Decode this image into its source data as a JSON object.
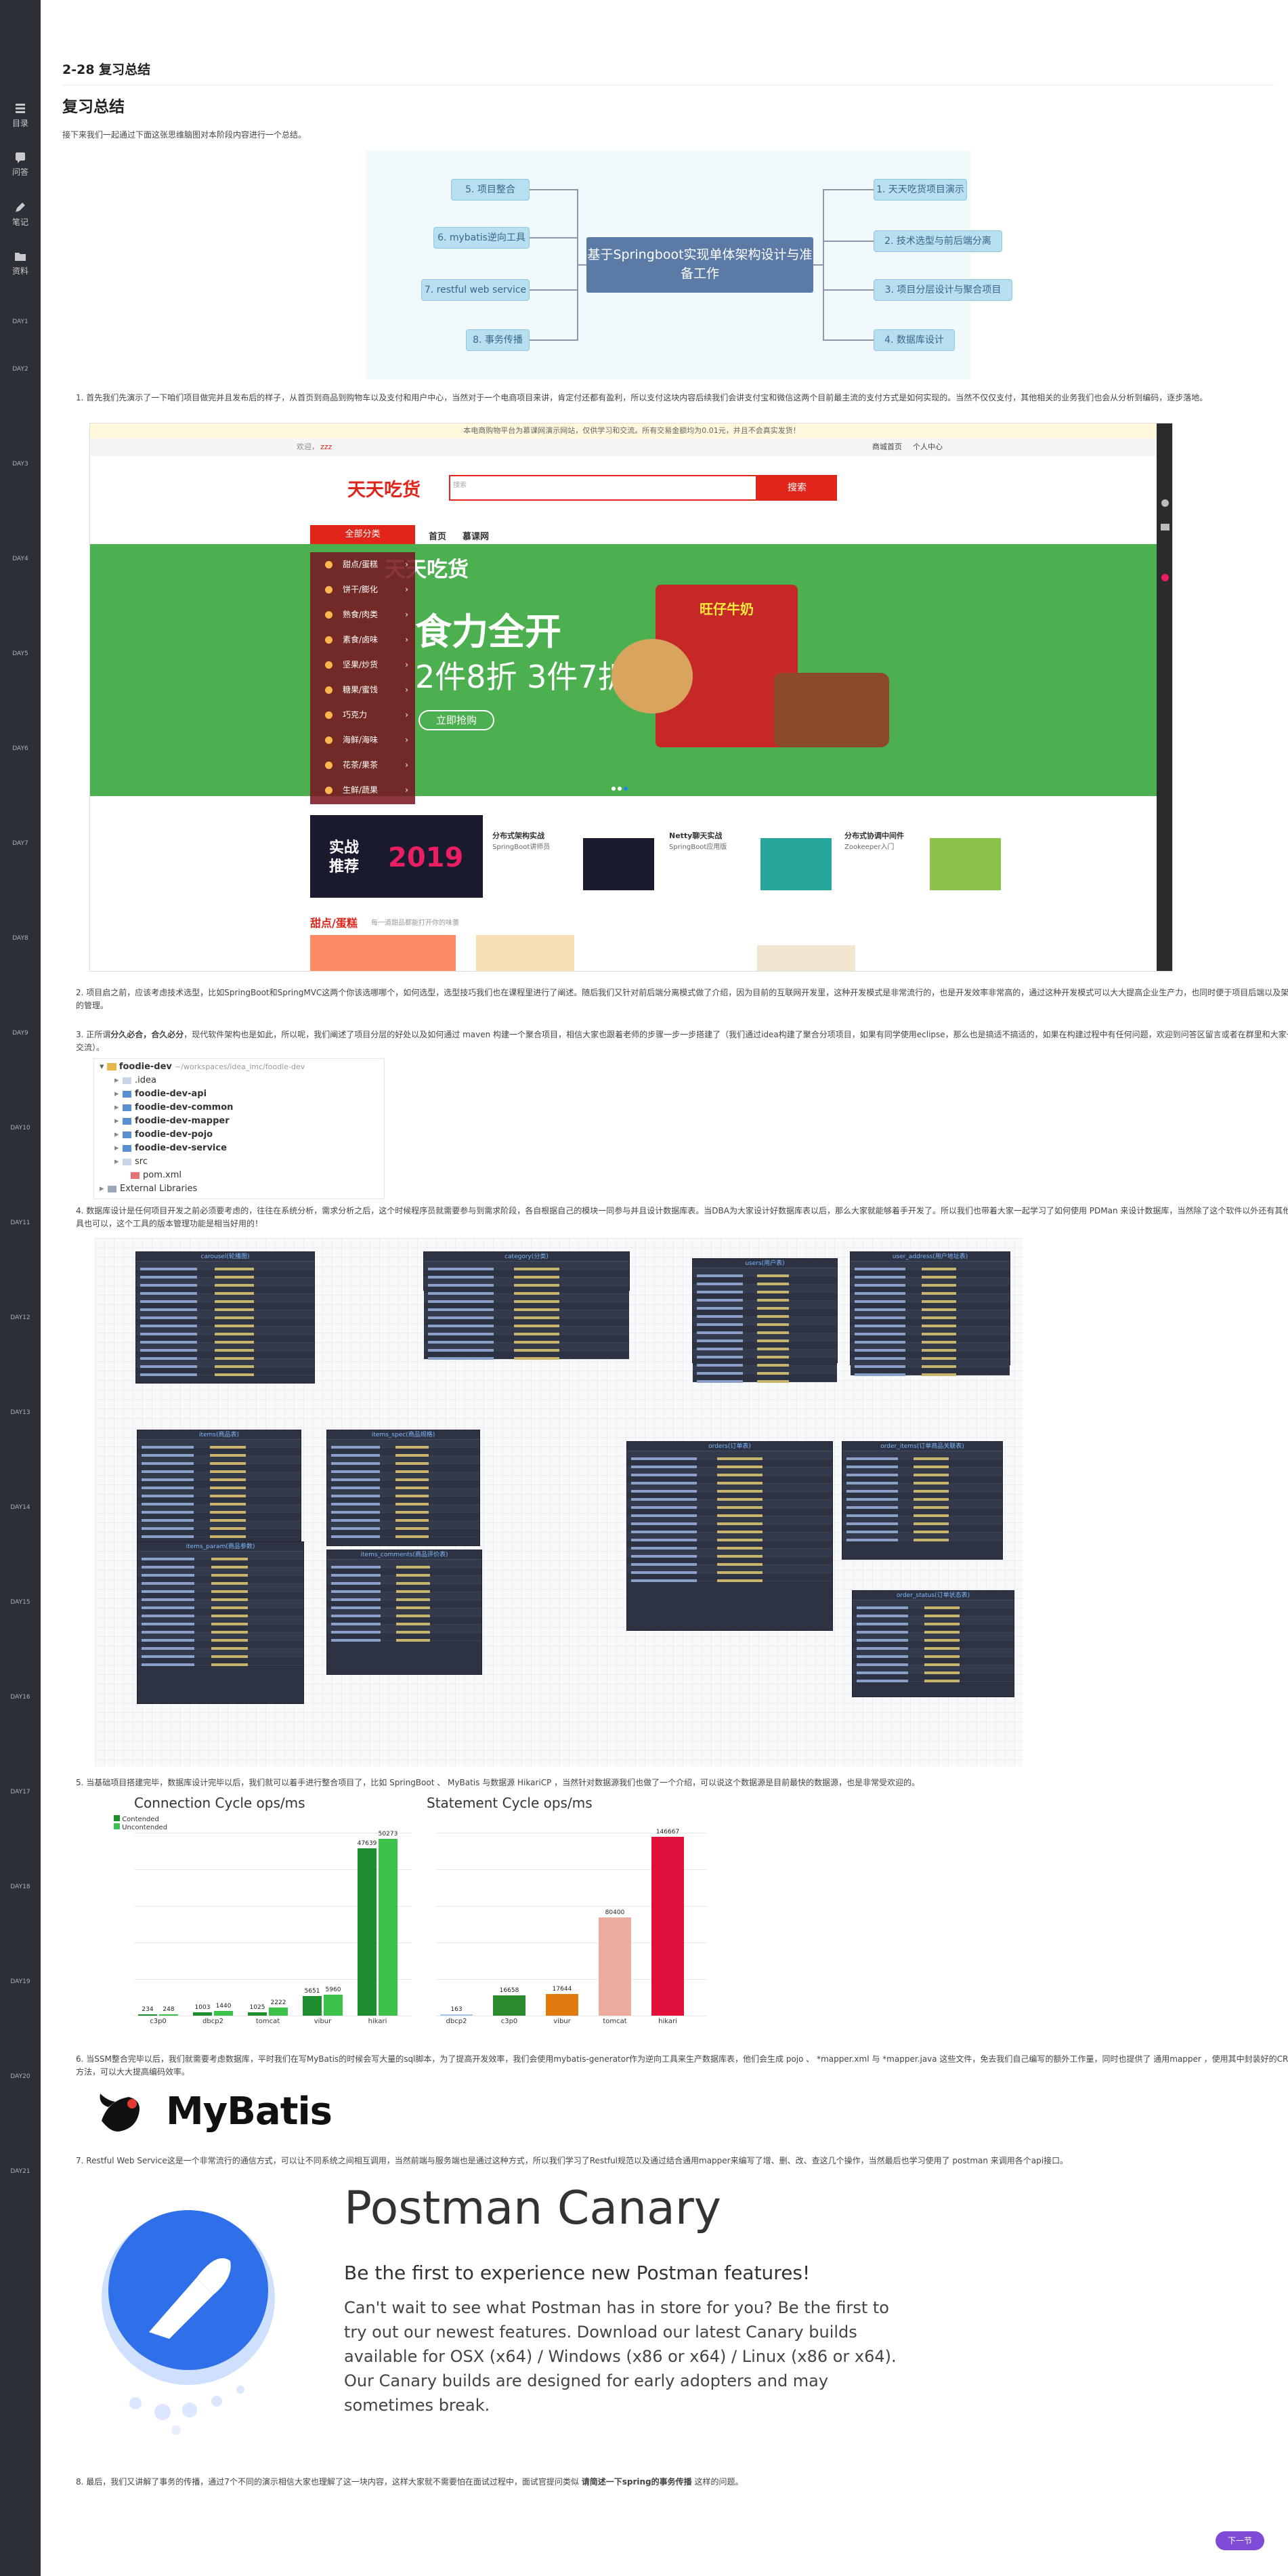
{
  "sidebar": {
    "items": [
      {
        "icon": "catalog-icon",
        "label": "目录"
      },
      {
        "icon": "question-icon",
        "label": "问答"
      },
      {
        "icon": "pen-icon",
        "label": "笔记"
      },
      {
        "icon": "folder-icon",
        "label": "资料"
      }
    ],
    "day_labels": [
      "DAY1",
      "DAY2",
      "DAY3",
      "DAY4",
      "DAY5",
      "DAY6",
      "DAY7",
      "DAY8",
      "DAY9",
      "DAY10",
      "DAY11",
      "DAY12",
      "DAY13",
      "DAY14",
      "DAY15",
      "DAY16",
      "DAY17",
      "DAY18",
      "DAY19",
      "DAY20",
      "DAY21"
    ]
  },
  "lesson": {
    "breadcrumb_title": "2-28 复习总结",
    "page_title": "复习总结",
    "intro": "接下来我们一起通过下面这张思维脑图对本阶段内容进行一个总结。"
  },
  "mindmap": {
    "center": "基于Springboot实现单体架构设计与准备工作",
    "left": [
      "5. 项目整合",
      "6. mybatis逆向工具",
      "7. restful web service",
      "8. 事务传播"
    ],
    "right": [
      "1. 天天吃货项目演示",
      "2. 技术选型与前后端分离",
      "3. 项目分层设计与聚合项目",
      "4. 数据库设计"
    ]
  },
  "points": {
    "p1": "首先我们先演示了一下咱们项目做完并且发布后的样子，从首页到商品到购物车以及支付和用户中心，当然对于一个电商项目来讲，肯定付还都有盈利，所以支付这块内容后续我们会讲支付宝和微信这两个目前最主流的支付方式是如何实现的。当然不仅仅支付，其他相关的业务我们也会从分析到编码，逐步落地。",
    "p2": "项目启之前，应该考虑技术选型，比如SpringBoot和SpringMVC这两个你该选哪哪个，如何选型，选型技巧我们也在课程里进行了阐述。随后我们又针对前后端分离模式做了介绍，因为目前的互联网开发里，这种开发模式是非常流行的，也是开发效率非常高的，通过这种开发模式可以大大提高企业生产力，也同时便于项目后端以及架构间的管理。",
    "p3_lead": "正所谓",
    "p3_bold": "分久必合，合久必分",
    "p3_rest": "，现代软件架构也是如此，所以呢，我们阐述了项目分层的好处以及如何通过 maven 构建一个聚合项目，相信大家也跟着老师的步骤一步一步搭建了（我们通过idea构建了聚合分项项目，如果有同学使用eclipse，那么也是搞适不搞适的，如果在构建过程中有任何问题，欢迎到问答区留言或者在群里和大家一起交流）。",
    "p4": "数据库设计是任何项目开发之前必须要考虑的，往往在系统分析，需求分析之后，这个时候程序员就需要参与到需求阶段，各自根据自己的模块一同参与并且设计数据库表。当DBA为大家设计好数据库表以后，那么大家就能够着手开发了。所以我们也带着大家一起学习了如何使用 PDMan 来设计数据库，当然除了这个软件以外还有其他的工具也可以，这个工具的版本管理功能是相当好用的！",
    "p5": "当基础项目搭建完毕，数据库设计完毕以后，我们就可以着手进行整合项目了，比如 SpringBoot 、 MyBatis 与数据源 HikariCP ，当然针对数据源我们也做了一个介绍，可以说这个数据源是目前最快的数据源，也是非常受欢迎的。",
    "p6": "当SSM整合完毕以后，我们就需要考虑数据库，平时我们在写MyBatis的时候会写大量的sql脚本，为了提高开发效率，我们会使用mybatis-generator作为逆向工具来生产数据库表，他们会生成 pojo 、 *mapper.xml 与 *mapper.java 这些文件，免去我们自己编写的额外工作量，同时也提供了 通用mapper ，使用其中封装好的CRUD方法，可以大大提高编码效率。",
    "p7": "Restful Web Service这是一个非常流行的通信方式，可以让不同系统之间相互调用，当然前端与服务端也是通过这种方式，所以我们学习了Restful规范以及通过结合通用mapper来编写了增、删、改、查这几个操作，当然最后也学习使用了 postman 来调用各个api接口。",
    "p8_lead": "最后，我们又讲解了事务的传播，通过7个不同的演示相信大家也理解了这一块内容，这样大家就不需要怕在面试过程中，面试官提问类似 ",
    "p8_bold": "请简述一下spring的事务传播",
    "p8_rest": " 这样的问题。"
  },
  "shop": {
    "notice": "本电商购物平台为慕课网演示网站，仅供学习和交流。所有交易金额均为0.01元，并且不会真实发货！",
    "welcome": "欢迎，",
    "username": "zzz",
    "links": [
      "商城首页",
      "个人中心"
    ],
    "logo": "天天吃货",
    "search_placeholder": "搜索",
    "search_button": "搜索",
    "nav": [
      "全部分类",
      "首页",
      "慕课网"
    ],
    "categories": [
      "甜点/蛋糕",
      "饼干/膨化",
      "熟食/肉类",
      "素食/卤味",
      "坚果/炒货",
      "糖果/蜜饯",
      "巧克力",
      "海鲜/海味",
      "花茶/果茶",
      "生鲜/蔬果"
    ],
    "banner_logo": "天天吃货",
    "banner_line1": "食力全开",
    "banner_line2": "2件8折 3件7折",
    "banner_button": "立即抢购",
    "banner_product": "旺仔牛奶",
    "promo_tag": "实战推荐",
    "promo_year": "2019",
    "courses": [
      {
        "title": "分布式架构实战",
        "sub": "SpringBoot讲师员"
      },
      {
        "title": "Netty聊天实战",
        "sub": "SpringBoot应用版"
      },
      {
        "title": "分布式协调中间件",
        "sub": "Zookeeper入门"
      }
    ],
    "section_title": "甜点/蛋糕",
    "section_sub": "每一道甜品都能打开你的味蕾"
  },
  "tree": {
    "root": "foodie-dev",
    "root_path": "~/workspaces/idea_imc/foodie-dev",
    "items": [
      ".idea",
      "foodie-dev-api",
      "foodie-dev-common",
      "foodie-dev-mapper",
      "foodie-dev-pojo",
      "foodie-dev-service",
      "src",
      "pom.xml",
      "External Libraries"
    ]
  },
  "db": {
    "tables": [
      "carousel(轮播图)",
      "category(分类)",
      "users(用户表)",
      "user_address(用户地址表)",
      "items(商品表)",
      "items_spec(商品规格)",
      "orders(订单表)",
      "order_items(订单商品关联表)",
      "items_param(商品参数)",
      "items_comments(商品评价表)",
      "order_status(订单状态表)"
    ]
  },
  "charts": {
    "left_title": "Connection Cycle ops/ms",
    "left_legend": [
      "Contended",
      "Uncontended"
    ],
    "right_title": "Statement Cycle ops/ms"
  },
  "chart_data": [
    {
      "type": "bar",
      "title": "Connection Cycle ops/ms",
      "categories": [
        "c3p0",
        "dbcp2",
        "tomcat",
        "vibur",
        "hikari"
      ],
      "series": [
        {
          "name": "Contended",
          "values": [
            234,
            1003,
            1025,
            5651,
            47639
          ]
        },
        {
          "name": "Uncontended",
          "values": [
            248,
            1440,
            2222,
            5960,
            50273
          ]
        }
      ],
      "ylim": [
        0,
        52000
      ]
    },
    {
      "type": "bar",
      "title": "Statement Cycle ops/ms",
      "categories": [
        "dbcp2",
        "c3p0",
        "vibur",
        "tomcat",
        "hikari"
      ],
      "values": [
        163,
        16658,
        17644,
        80400,
        146667
      ],
      "ylim": [
        0,
        150000
      ]
    }
  ],
  "mybatis": {
    "wordmark": "MyBatis"
  },
  "postman": {
    "title": "Postman Canary",
    "subtitle": "Be the first to experience new Postman features!",
    "body": "Can't wait to see what Postman has in store for you? Be the first to try out our newest features. Download our latest Canary builds available for OSX (x64) / Windows (x86 or x64) / Linux (x86 or x64). Our Canary builds are designed for early adopters and may sometimes break."
  },
  "next_button": "下一节",
  "colors": {
    "brand_red": "#e1251b",
    "banner_green": "#4caf50",
    "sidebar": "#2d2f36",
    "next": "#7d4bd6"
  }
}
